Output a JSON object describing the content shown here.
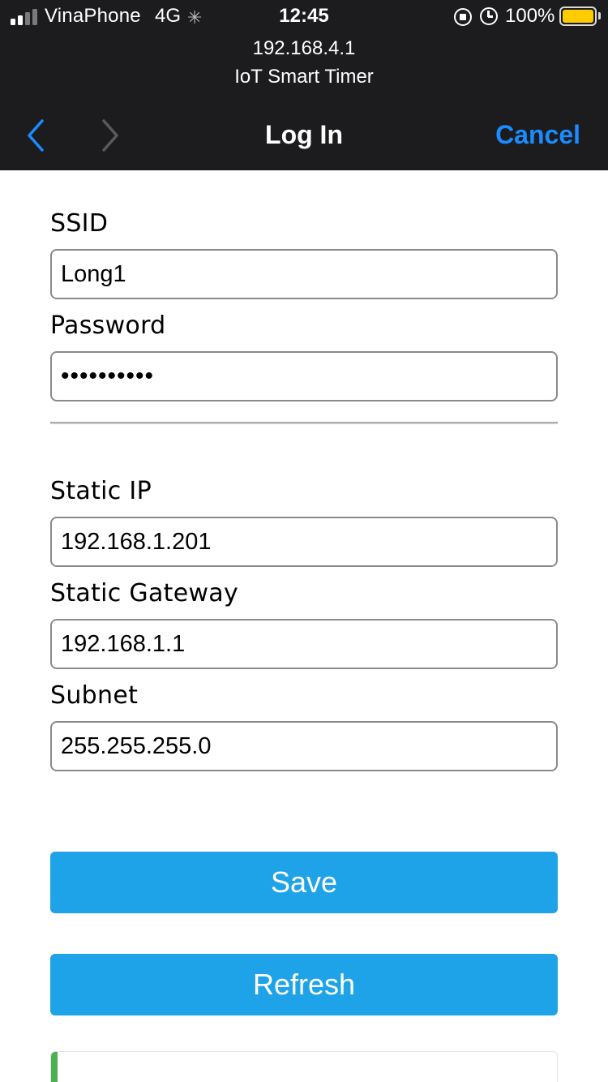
{
  "status_bar": {
    "carrier": "VinaPhone",
    "network": "4G",
    "time": "12:45",
    "battery_percent": "100%",
    "signal_bars_active": 2,
    "signal_bars_total": 4,
    "battery_level": 1.0,
    "battery_color": "#ffcc00"
  },
  "browser": {
    "host": "192.168.4.1",
    "site_name": "IoT Smart Timer",
    "title": "Log In",
    "cancel_label": "Cancel",
    "accent_color": "#1a8cff"
  },
  "form": {
    "ssid_label": "SSID",
    "ssid_value": "Long1",
    "password_label": "Password",
    "password_value": "••••••••••",
    "static_ip_label": "Static IP",
    "static_ip_value": "192.168.1.201",
    "gateway_label": "Static Gateway",
    "gateway_value": "192.168.1.1",
    "subnet_label": "Subnet",
    "subnet_value": "255.255.255.0"
  },
  "buttons": {
    "save_label": "Save",
    "refresh_label": "Refresh",
    "button_color": "#1fa3e8"
  },
  "icons": {
    "back": "chevron-left-icon",
    "forward": "chevron-right-icon",
    "orientation_lock": "orientation-lock-icon",
    "alarm": "alarm-icon",
    "loading": "loading-spinner-icon"
  }
}
